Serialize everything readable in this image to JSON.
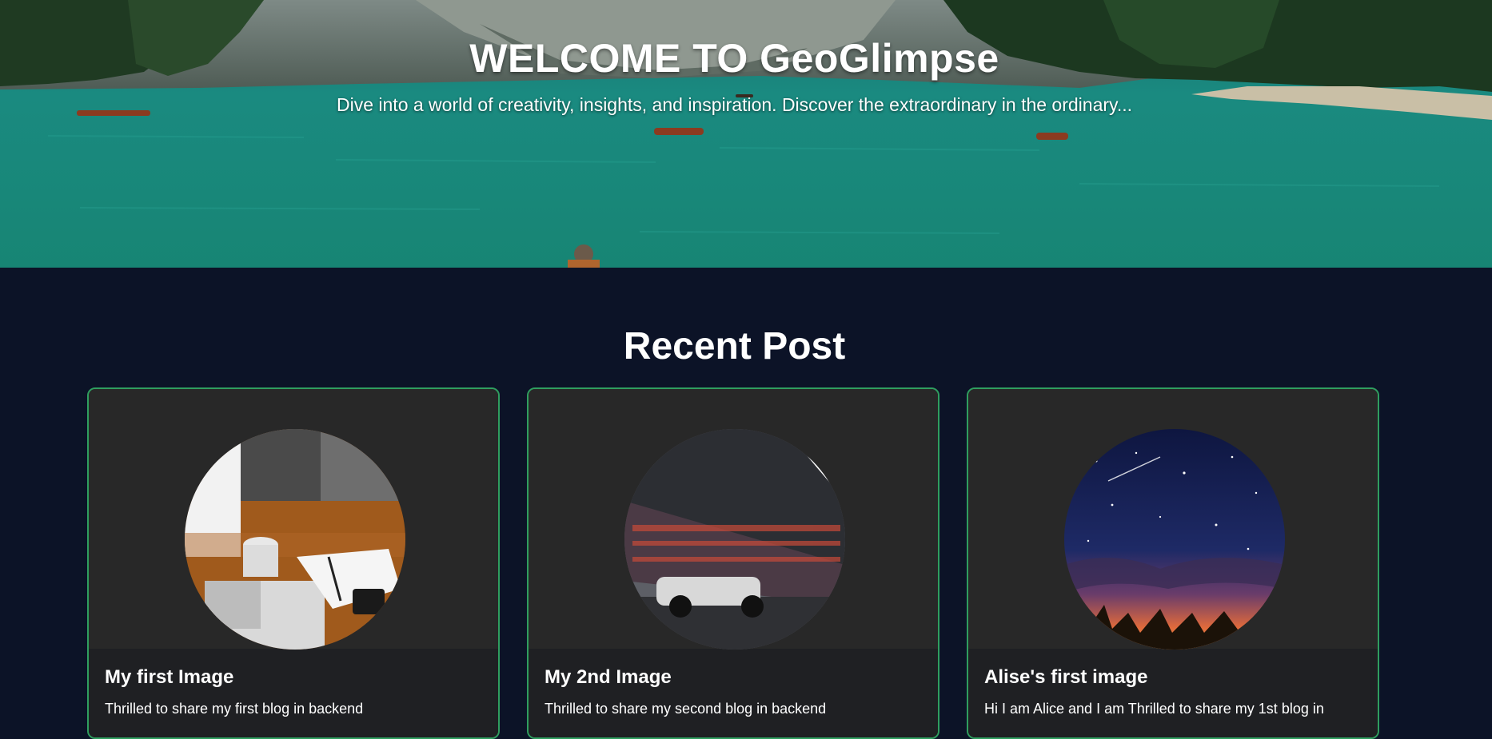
{
  "hero": {
    "title": "WELCOME TO GeoGlimpse",
    "subtitle": "Dive into a world of creativity, insights, and inspiration. Discover the extraordinary in the ordinary..."
  },
  "section": {
    "title": "Recent Post"
  },
  "posts": [
    {
      "title": "My first Image",
      "excerpt": "Thrilled to share my first blog in backend"
    },
    {
      "title": "My 2nd Image",
      "excerpt": "Thrilled to share my second blog in backend"
    },
    {
      "title": "Alise's first image",
      "excerpt": "Hi I am Alice and I am Thrilled to share my 1st blog in"
    }
  ],
  "colors": {
    "page_background": "#0c1327",
    "card_border": "#2f9e5f",
    "card_media_background": "#282828",
    "card_body_background": "#1f2023",
    "text": "#ffffff"
  }
}
